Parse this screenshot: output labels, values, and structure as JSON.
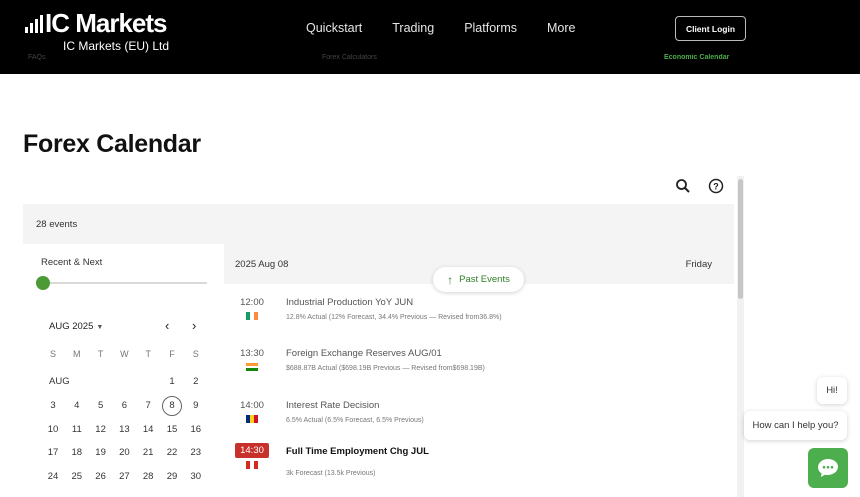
{
  "header": {
    "logo_text": "IC Markets",
    "logo_subtitle": "IC Markets (EU) Ltd",
    "nav": [
      "Quickstart",
      "Trading",
      "Platforms",
      "More"
    ],
    "login_label": "Client Login",
    "subnav": [
      "FAQs",
      "Forex Calculators",
      "Economic Calendar"
    ]
  },
  "page_title": "Forex Calendar",
  "events_count": "28 events",
  "filter": {
    "label": "Recent & Next"
  },
  "calendar": {
    "month": "AUG 2025",
    "weekdays": [
      "S",
      "M",
      "T",
      "W",
      "T",
      "F",
      "S"
    ],
    "month_short": "AUG",
    "rows": [
      [
        "",
        "",
        "",
        "",
        "",
        "1",
        "2"
      ],
      [
        "3",
        "4",
        "5",
        "6",
        "7",
        "8",
        "9"
      ],
      [
        "10",
        "11",
        "12",
        "13",
        "14",
        "15",
        "16"
      ],
      [
        "17",
        "18",
        "19",
        "20",
        "21",
        "22",
        "23"
      ],
      [
        "24",
        "25",
        "26",
        "27",
        "28",
        "29",
        "30"
      ]
    ],
    "selected": "8"
  },
  "day_header": {
    "date": "2025 Aug 08",
    "day": "Friday"
  },
  "past_events_label": "Past Events",
  "events": [
    {
      "time": "12:00",
      "title": "Industrial Production YoY JUN",
      "detail": "12.8% Actual (12% Forecast, 34.4% Previous — Revised from36.8%)",
      "flag": [
        "#169b62",
        "#ffffff",
        "#ff883e"
      ],
      "highlight": false
    },
    {
      "time": "13:30",
      "title": "Foreign Exchange Reserves AUG/01",
      "detail": "$688.87B Actual ($698.19B Previous — Revised from$698.19B)",
      "flag": [
        "#ff9933",
        "#ffffff",
        "#138808"
      ],
      "highlight": false,
      "horizontal": true
    },
    {
      "time": "14:00",
      "title": "Interest Rate Decision",
      "detail": "6.5% Actual (6.5% Forecast, 6.5% Previous)",
      "flag": [
        "#002b7f",
        "#fcd116",
        "#ce1126"
      ],
      "highlight": false
    },
    {
      "time": "14:30",
      "title": "Full Time Employment Chg JUL",
      "detail": "3k Forecast (13.5k Previous)",
      "flag": [
        "#d52b1e",
        "#ffffff",
        "#d52b1e"
      ],
      "highlight": true
    }
  ],
  "chat": {
    "greeting": "Hi!",
    "prompt": "How can I help you?"
  },
  "colors": {
    "accent_green": "#4b9a36",
    "highlight_red": "#c8312b"
  }
}
